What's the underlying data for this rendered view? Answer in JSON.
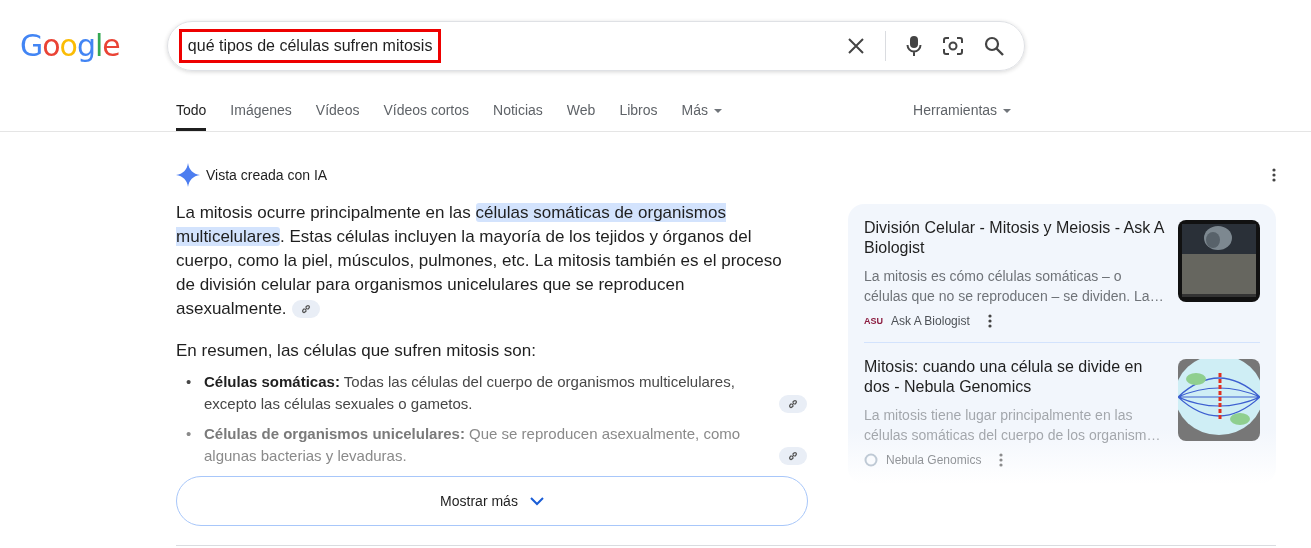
{
  "logo": "Google",
  "search": {
    "value": "qué tipos de células sufren mitosis",
    "marked": true
  },
  "tabs": [
    {
      "label": "Todo",
      "selected": true,
      "kind": "tab"
    },
    {
      "label": "Imágenes",
      "selected": false,
      "kind": "tab"
    },
    {
      "label": "Vídeos",
      "selected": false,
      "kind": "tab"
    },
    {
      "label": "Vídeos cortos",
      "selected": false,
      "kind": "tab"
    },
    {
      "label": "Noticias",
      "selected": false,
      "kind": "tab"
    },
    {
      "label": "Web",
      "selected": false,
      "kind": "tab"
    },
    {
      "label": "Libros",
      "selected": false,
      "kind": "tab"
    },
    {
      "label": "Más",
      "selected": false,
      "kind": "menu"
    }
  ],
  "tools": "Herramientas",
  "overview": {
    "label": "Vista creada con IA",
    "paragraph": [
      {
        "text": "La mitosis ocurre principalmente en las ",
        "highlighted": false
      },
      {
        "text": "células somáticas de organismos multicelulares",
        "highlighted": true
      },
      {
        "text": ". Estas células incluyen la mayoría de los tejidos y órganos del cuerpo, como la piel, músculos, pulmones, etc. La mitosis también es el proceso de división celular para organismos unicelulares que se reproducen asexualmente.",
        "highlighted": false
      }
    ],
    "summary": "En resumen, las células que sufren mitosis son:",
    "items": [
      {
        "marker": "•",
        "text": "**Células somáticas:** Todas las células del cuerpo de organismos multicelulares, excepto las células sexuales o gametos.",
        "faded": false
      },
      {
        "marker": "•",
        "text": "**Células de organismos unicelulares:** Que se reproducen asexualmente, como algunas bacterias y levaduras.",
        "faded": true
      }
    ],
    "more": "Mostrar más"
  },
  "sources": [
    {
      "title": "División Celular - Mitosis y Meiosis - Ask A Biologist",
      "snippet": "La mitosis es cómo células somáticas – o células que no se reproducen – se dividen. La…",
      "site": "Ask A Biologist",
      "favicon": "ASU",
      "faded": false,
      "kind": "dark"
    },
    {
      "title": "Mitosis: cuando una célula se divide en dos - Nebula Genomics",
      "snippet": "La mitosis tiene lugar principalmente en las células somáticas del cuerpo de los organism…",
      "site": "Nebula Genomics",
      "faded": true,
      "kind": "spindle"
    }
  ]
}
